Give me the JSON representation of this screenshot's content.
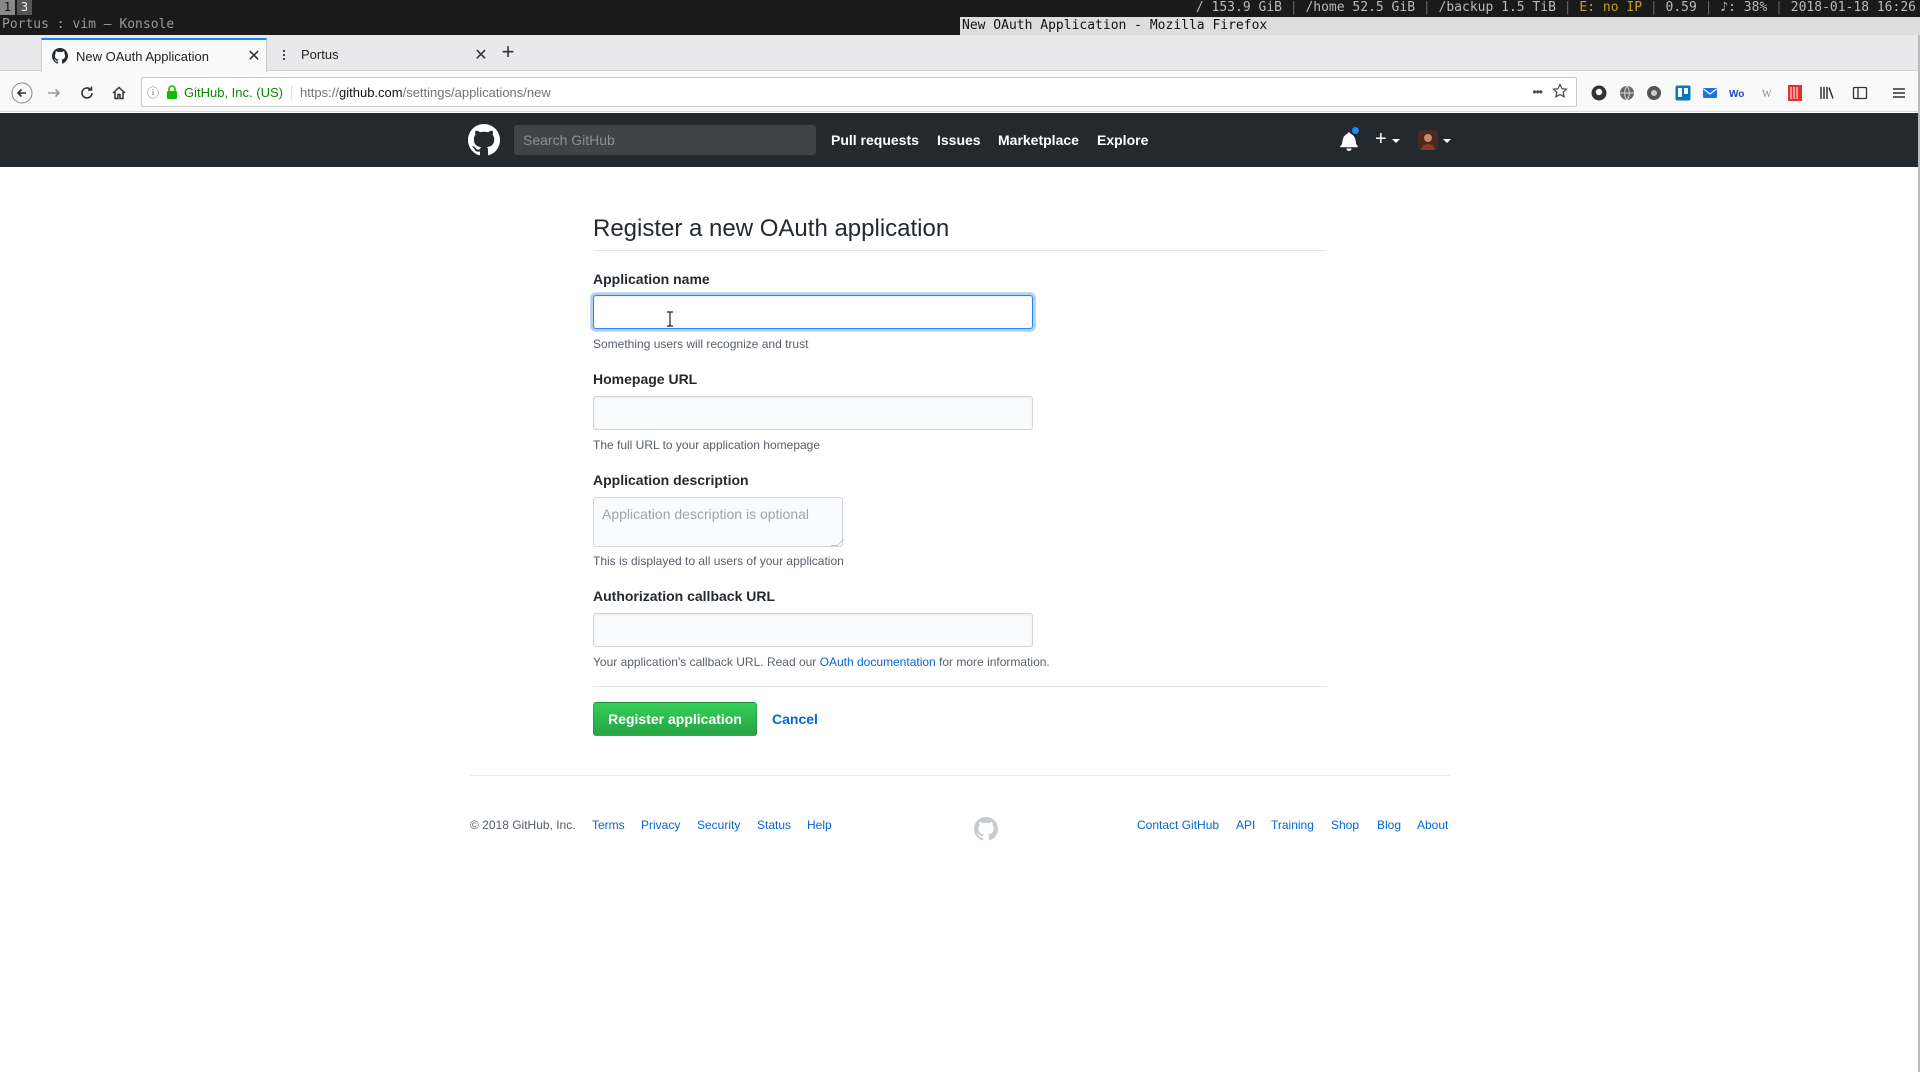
{
  "wm": {
    "workspaces": [
      "1",
      "3"
    ],
    "left_title": "Portus : vim — Konsole",
    "active_window_title": "New OAuth Application - Mozilla Firefox",
    "status": {
      "root": "/ 153.9 GiB",
      "home": "/home 52.5 GiB",
      "backup": "/backup 1.5 TiB",
      "net": "E: no IP",
      "load": "0.59",
      "volume": "♪: 38%",
      "datetime": "2018-01-18 16:26"
    }
  },
  "browser": {
    "tabs": [
      {
        "title": "New OAuth Application",
        "icon": "github-icon",
        "active": true
      },
      {
        "title": "Portus",
        "icon": "page-icon",
        "active": false
      }
    ],
    "url_identity": "GitHub, Inc. (US)",
    "url_scheme": "https://",
    "url_host": "github.com",
    "url_path": "/settings/applications/new",
    "overflow_menu": "•••"
  },
  "github": {
    "search_placeholder": "Search GitHub",
    "nav": [
      "Pull requests",
      "Issues",
      "Marketplace",
      "Explore"
    ],
    "plus": "+"
  },
  "form": {
    "title": "Register a new OAuth application",
    "app_name_label": "Application name",
    "app_name_value": "",
    "app_name_note": "Something users will recognize and trust",
    "homepage_label": "Homepage URL",
    "homepage_value": "",
    "homepage_note": "The full URL to your application homepage",
    "description_label": "Application description",
    "description_placeholder": "Application description is optional",
    "description_note": "This is displayed to all users of your application",
    "callback_label": "Authorization callback URL",
    "callback_value": "",
    "callback_note_prefix": "Your application's callback URL. Read our ",
    "callback_note_link": "OAuth documentation",
    "callback_note_suffix": " for more information.",
    "register_button": "Register application",
    "cancel_link": "Cancel"
  },
  "footer": {
    "copyright": "© 2018 GitHub, Inc.",
    "left_links": [
      "Terms",
      "Privacy",
      "Security",
      "Status",
      "Help"
    ],
    "right_links": [
      "Contact GitHub",
      "API",
      "Training",
      "Shop",
      "Blog",
      "About"
    ]
  },
  "colors": {
    "gh_header_bg": "#24292e",
    "link_blue": "#0366d6",
    "button_green": "#28a745",
    "focus_blue": "#2188ff"
  }
}
